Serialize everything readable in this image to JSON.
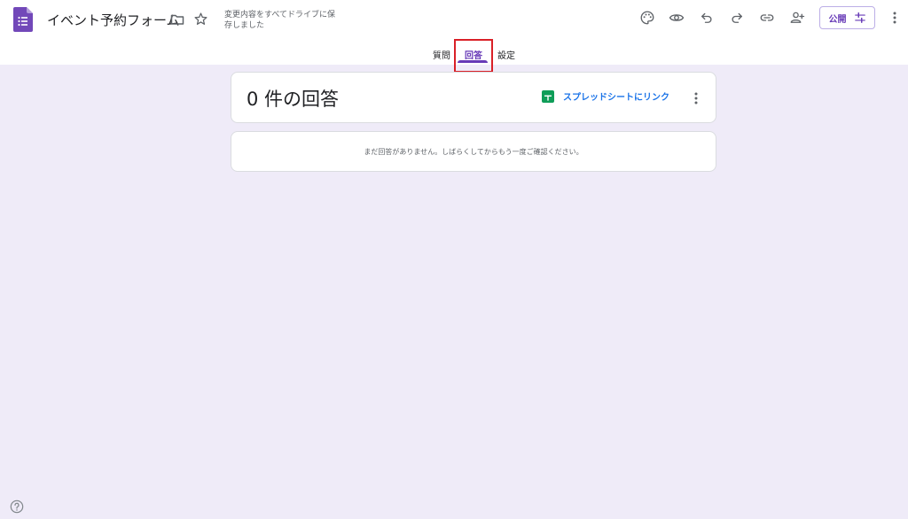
{
  "app": {
    "title": "イベント予約フォーム",
    "save_status": "変更内容をすべてドライブに保存しました"
  },
  "header": {
    "publish_label": "公開"
  },
  "tabs": [
    {
      "label": "質問",
      "active": false
    },
    {
      "label": "回答",
      "active": true
    },
    {
      "label": "設定",
      "active": false
    }
  ],
  "responses": {
    "count_title": "0 件の回答",
    "sheet_link_label": "スプレッドシートにリンク",
    "empty_message": "まだ回答がありません。しばらくしてからもう一度ご確認ください。"
  },
  "colors": {
    "accent": "#673ab7",
    "background": "#efebf8",
    "link": "#1a73e8",
    "sheets_green": "#0f9d58",
    "highlight": "#d92027"
  }
}
